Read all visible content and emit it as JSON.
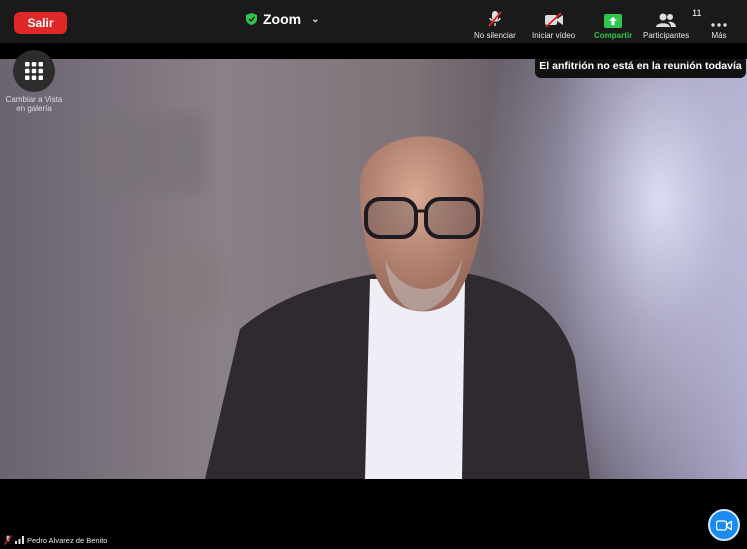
{
  "topbar": {
    "leave_label": "Salir",
    "app_title": "Zoom",
    "tools": [
      {
        "label": "No silenciar",
        "icon": "microphone-muted-icon"
      },
      {
        "label": "Iniciar vídeo",
        "icon": "video-off-icon"
      },
      {
        "label": "Compartir",
        "icon": "share-screen-icon"
      },
      {
        "label": "Participantes",
        "icon": "participants-icon",
        "count": "11"
      },
      {
        "label": "Más",
        "icon": "more-dots-icon"
      }
    ]
  },
  "gallery": {
    "label": "Cambiar a Vista en galería",
    "icon": "grid-icon"
  },
  "tooltip": "El anfitrión no está en la reunión todavía",
  "participant": {
    "name": "Pedro Alvarez de Benito"
  },
  "colors": {
    "leave": "#e02828",
    "share": "#2ec74b",
    "video_fab": "#1b8bf2",
    "background": "#1a1a1a"
  }
}
